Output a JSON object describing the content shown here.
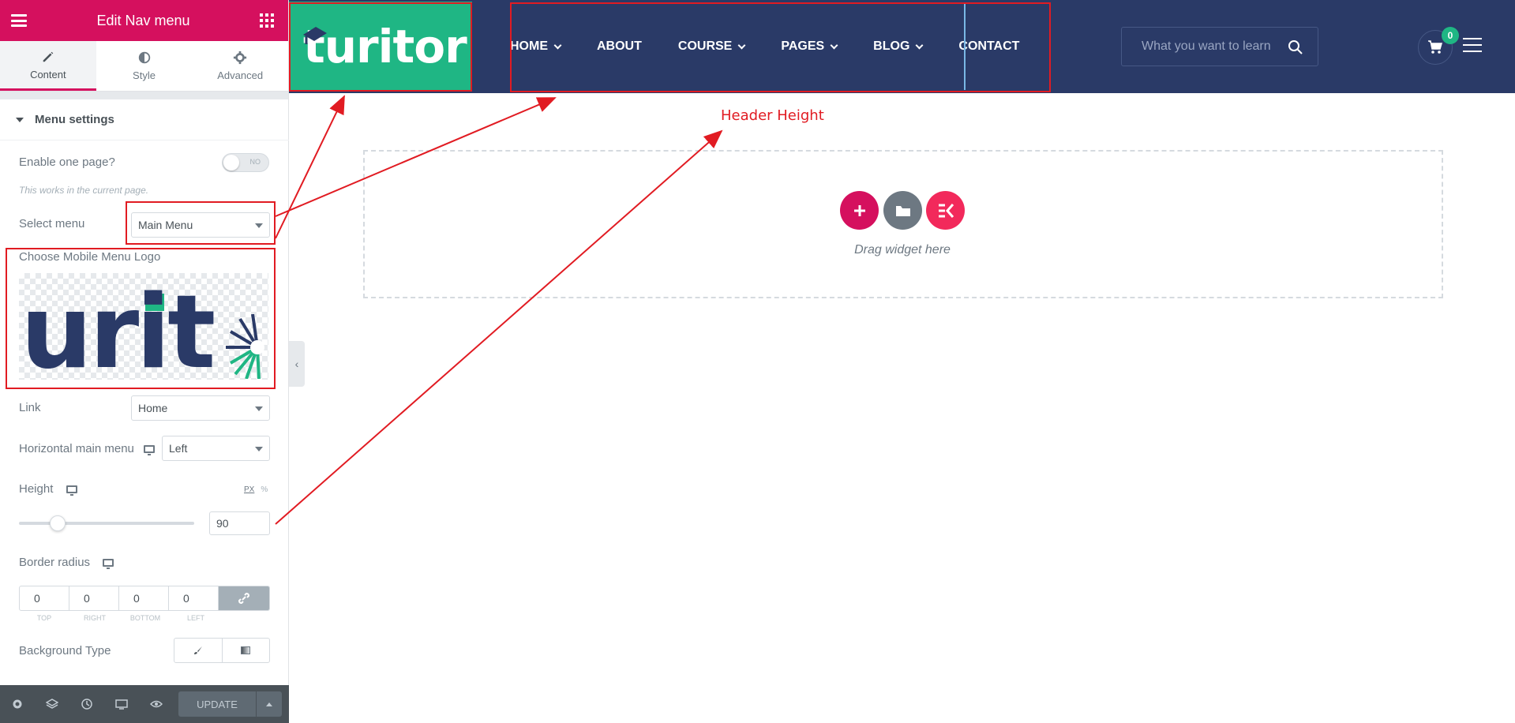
{
  "panel": {
    "title": "Edit Nav menu",
    "tabs": [
      {
        "label": "Content",
        "icon": "pencil-icon",
        "active": true
      },
      {
        "label": "Style",
        "icon": "half-circle-icon",
        "active": false
      },
      {
        "label": "Advanced",
        "icon": "gear-icon",
        "active": false
      }
    ],
    "section_title": "Menu settings",
    "enable_one_page_label": "Enable one page?",
    "enable_one_page_value": "NO",
    "enable_one_page_hint": "This works in the current page.",
    "select_menu_label": "Select menu",
    "select_menu_value": "Main Menu",
    "mobile_logo_label": "Choose Mobile Menu Logo",
    "mobile_logo_text": "urit",
    "link_label": "Link",
    "link_value": "Home",
    "horizontal_label": "Horizontal main menu",
    "horizontal_value": "Left",
    "height_label": "Height",
    "height_unit_px": "PX",
    "height_unit_pct": "%",
    "height_value": "90",
    "border_radius_label": "Border radius",
    "border_radius": {
      "values": [
        "0",
        "0",
        "0",
        "0"
      ],
      "labels": [
        "TOP",
        "RIGHT",
        "BOTTOM",
        "LEFT"
      ]
    },
    "background_type_label": "Background Type",
    "footer": {
      "icons": [
        "settings-icon",
        "layers-icon",
        "history-icon",
        "responsive-icon",
        "preview-icon"
      ],
      "update_label": "UPDATE"
    }
  },
  "site": {
    "logo_text": "turitor",
    "nav": [
      "HOME",
      "ABOUT",
      "COURSE",
      "PAGES",
      "BLOG",
      "CONTACT"
    ],
    "search_placeholder": "What you want to learn",
    "cart_count": "0"
  },
  "canvas": {
    "drag_text": "Drag widget here"
  },
  "annotation": {
    "label": "Header Height",
    "color": "#e11b22"
  },
  "colors": {
    "brand_pink": "#d5105e",
    "header_navy": "#2a3a67",
    "logo_green": "#1fb684"
  }
}
